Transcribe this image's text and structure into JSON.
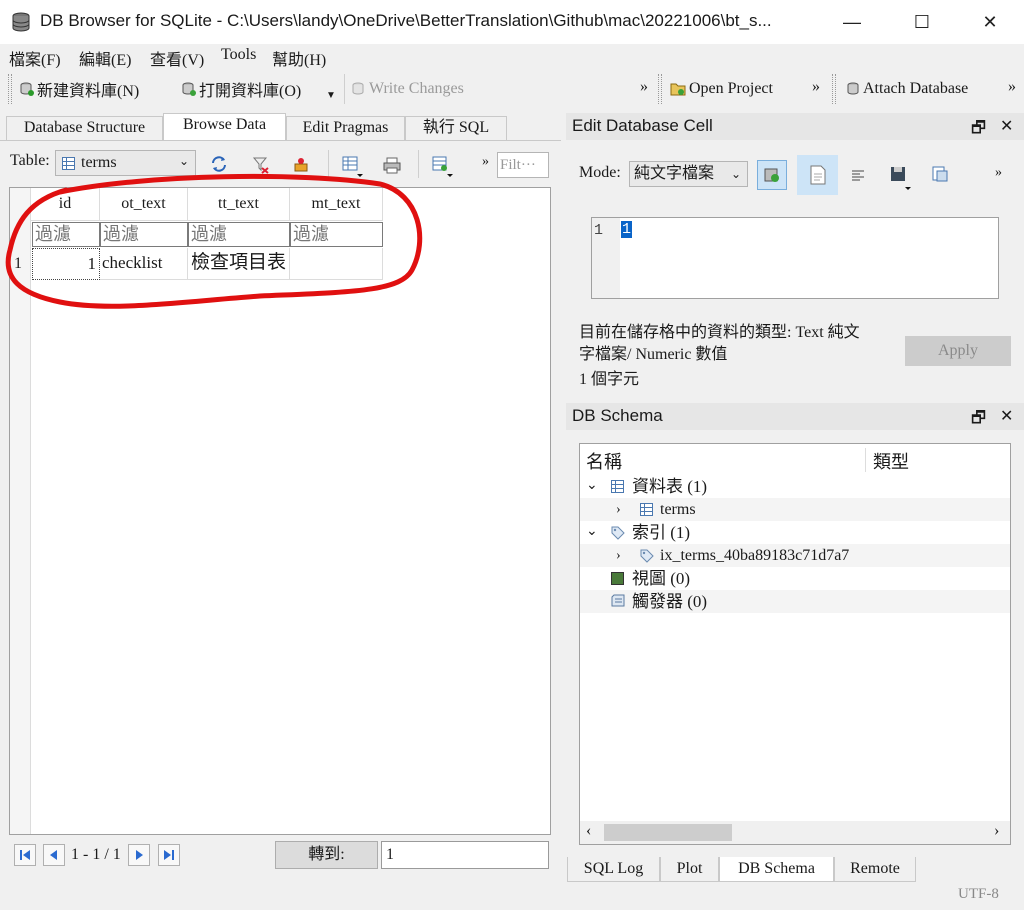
{
  "window": {
    "title": "DB Browser for SQLite - C:\\Users\\landy\\OneDrive\\BetterTranslation\\Github\\mac\\20221006\\bt_s...",
    "minimize": "—",
    "maximize": "☐",
    "close": "✕"
  },
  "menu": [
    "檔案(F)",
    "編輯(E)",
    "查看(V)",
    "Tools",
    "幫助(H)"
  ],
  "toolbar": {
    "new_db": "新建資料庫(N)",
    "open_db": "打開資料庫(O)",
    "write_changes": "Write Changes",
    "open_project": "Open Project",
    "attach_db": "Attach Database",
    "more": "»"
  },
  "tabs": [
    "Database Structure",
    "Browse Data",
    "Edit Pragmas",
    "執行 SQL"
  ],
  "browse": {
    "table_label": "Table:",
    "table_value": "terms",
    "filter_placeholder": "Filt···",
    "columns": [
      "id",
      "ot_text",
      "tt_text",
      "mt_text"
    ],
    "filter_text": "過濾",
    "rows": [
      {
        "rownum": "1",
        "id": "1",
        "ot_text": "checklist",
        "tt_text": "檢查項目表",
        "mt_text": ""
      }
    ],
    "page_info": "1 - 1 / 1",
    "goto_label": "轉到:",
    "goto_value": "1"
  },
  "edit_cell": {
    "title": "Edit Database Cell",
    "mode_label": "Mode:",
    "mode_value": "純文字檔案",
    "line_number": "1",
    "content": "1",
    "type_info_line1": "目前在儲存格中的資料的類型: Text 純文",
    "type_info_line2": "字檔案/ Numeric 數值",
    "char_count": "1 個字元",
    "apply": "Apply"
  },
  "schema": {
    "title": "DB Schema",
    "col_name": "名稱",
    "col_type": "類型",
    "tables": "資料表 (1)",
    "table_terms": "terms",
    "indexes": "索引 (1)",
    "index_name": "ix_terms_40ba89183c71d7a7",
    "views": "視圖 (0)",
    "triggers": "觸發器 (0)"
  },
  "bottom_tabs": [
    "SQL Log",
    "Plot",
    "DB Schema",
    "Remote"
  ],
  "status": {
    "encoding": "UTF-8"
  },
  "colors": {
    "annotation": "#e01010",
    "selection": "#0a64c8",
    "accent_button": "#cde4f7"
  }
}
